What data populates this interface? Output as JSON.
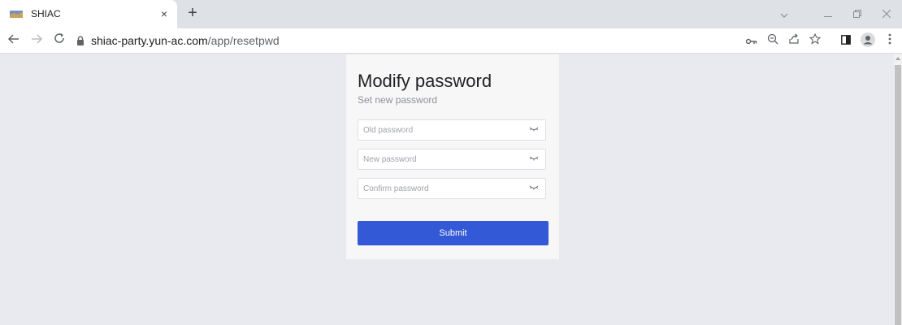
{
  "browser": {
    "tab": {
      "title": "SHIAC",
      "close_symbol": "×"
    },
    "new_tab_symbol": "+",
    "url_host": "shiac-party.yun-ac.com",
    "url_path": "/app/resetpwd"
  },
  "form": {
    "title": "Modify password",
    "subtitle": "Set new password",
    "old_password_placeholder": "Old password",
    "new_password_placeholder": "New password",
    "confirm_password_placeholder": "Confirm password",
    "submit_label": "Submit"
  },
  "colors": {
    "accent": "#3459d6",
    "page_bg": "#e9eaef",
    "card_bg": "#f7f7f8"
  }
}
